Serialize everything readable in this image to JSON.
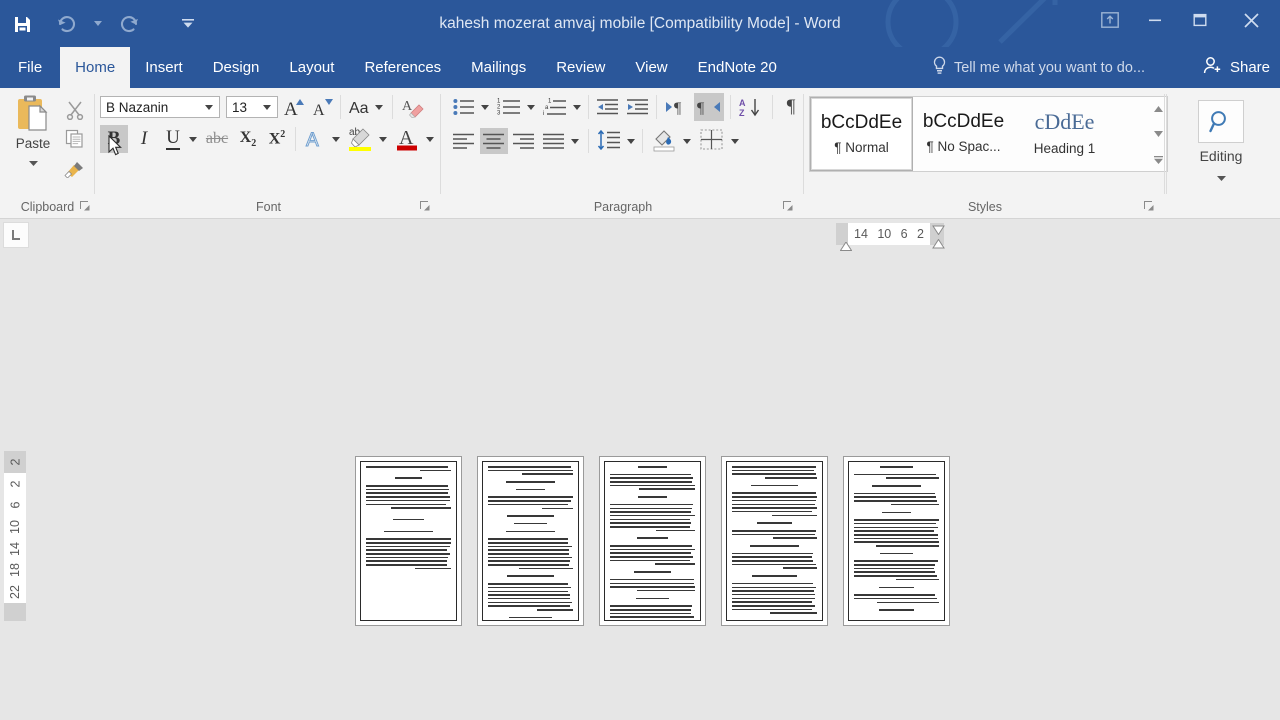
{
  "window": {
    "title": "kahesh mozerat amvaj mobile [Compatibility Mode] - Word",
    "accent_color": "#2b579a",
    "ribbon_bg": "#f3f3f3",
    "controls": {
      "ribbon_display_options": "Ribbon Display Options",
      "minimize": "Minimize",
      "restore": "Restore Down",
      "close": "Close"
    }
  },
  "quick_access": {
    "save": "Save",
    "undo": "Undo",
    "undo_dropdown": "Undo dropdown",
    "redo": "Repeat",
    "customize": "Customize Quick Access Toolbar"
  },
  "tabs": [
    {
      "label": "File",
      "active": false
    },
    {
      "label": "Home",
      "active": true
    },
    {
      "label": "Insert",
      "active": false
    },
    {
      "label": "Design",
      "active": false
    },
    {
      "label": "Layout",
      "active": false
    },
    {
      "label": "References",
      "active": false
    },
    {
      "label": "Mailings",
      "active": false
    },
    {
      "label": "Review",
      "active": false
    },
    {
      "label": "View",
      "active": false
    },
    {
      "label": "EndNote 20",
      "active": false
    }
  ],
  "tell_me": {
    "label": "Tell me what you want to do...",
    "icon": "lightbulb-icon"
  },
  "share": {
    "label": "Share",
    "icon": "share-person-icon"
  },
  "groups": {
    "clipboard": {
      "label": "Clipboard",
      "paste": "Paste",
      "cut": "Cut",
      "copy": "Copy",
      "format_painter": "Format Painter",
      "launcher": "Clipboard dialog box launcher"
    },
    "font": {
      "label": "Font",
      "font_family_value": "B Nazanin",
      "font_size_value": "13",
      "grow_font": "Grow Font",
      "shrink_font": "Shrink Font",
      "change_case": "Change Case",
      "clear_formatting": "Clear All Formatting",
      "bold": "B",
      "italic": "I",
      "underline": "U",
      "strikethrough": "abc",
      "subscript": "X₂",
      "superscript": "X²",
      "text_effects": "Text Effects and Typography",
      "highlight": "Text Highlight Color",
      "font_color": "Font Color",
      "highlight_color": "#ffff00",
      "font_color_swatch": "#cc0000",
      "launcher": "Font dialog box launcher"
    },
    "paragraph": {
      "label": "Paragraph",
      "bullets": "Bullets",
      "numbering": "Numbering",
      "multilevel": "Multilevel List",
      "decrease_indent": "Decrease Indent",
      "increase_indent": "Increase Indent",
      "ltr": "Left-to-Right Text Direction",
      "rtl": "Right-to-Left Text Direction",
      "sort": "Sort",
      "show_marks": "Show/Hide ¶",
      "align_left": "Align Left",
      "align_center": "Center",
      "align_right": "Align Right",
      "justify": "Justify",
      "line_spacing": "Line and Paragraph Spacing",
      "shading": "Shading",
      "borders": "Borders",
      "launcher": "Paragraph dialog box launcher"
    },
    "styles": {
      "label": "Styles",
      "launcher": "Styles dialog box launcher",
      "items": [
        {
          "preview": "bCcDdEe",
          "name": "¶ Normal",
          "selected": true,
          "heading": false
        },
        {
          "preview": "bCcDdEe",
          "name": "¶ No Spac...",
          "selected": false,
          "heading": false
        },
        {
          "preview": "cDdEe",
          "name": "Heading 1",
          "selected": false,
          "heading": true
        }
      ],
      "scroll_up": "Scroll up",
      "scroll_down": "Scroll down",
      "more": "More styles"
    },
    "editing": {
      "label": "Editing",
      "icon": "search-icon",
      "dropdown": "Editing dropdown"
    }
  },
  "rulers": {
    "tab_selector": "Left Tab",
    "horizontal_ticks": [
      "14",
      "10",
      "6",
      "2"
    ],
    "vertical_top_tick": "2",
    "vertical_ticks": [
      "2",
      "6",
      "10",
      "14",
      "18",
      "22"
    ]
  },
  "document": {
    "page_count": 5,
    "pages": [
      {
        "name": "page-1"
      },
      {
        "name": "page-2"
      },
      {
        "name": "page-3"
      },
      {
        "name": "page-4"
      },
      {
        "name": "page-5"
      }
    ]
  }
}
